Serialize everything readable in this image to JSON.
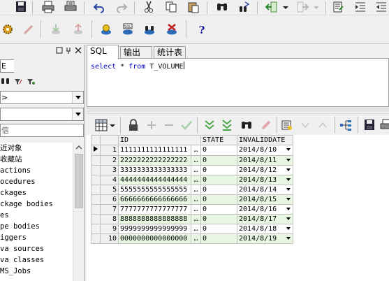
{
  "left_panel": {
    "filter_char": "E",
    "combo1": ">",
    "filter_text": "信",
    "tree_items": [
      "近对象",
      "收藏站",
      "actions",
      "ocedures",
      "ckages",
      "ckage bodies",
      "es",
      "pe bodies",
      "iggers",
      "va sources",
      "va classes",
      "MS_Jobs"
    ]
  },
  "sql_tabs": [
    "SQL",
    "输出",
    "统计表"
  ],
  "editor": {
    "kw_select": "select",
    "star": "*",
    "kw_from": "from",
    "table": "T_VOLUME"
  },
  "grid": {
    "columns": [
      "ID",
      "STATE",
      "INVALIDDATE"
    ],
    "ellipsis": "…",
    "rows": [
      {
        "n": "1",
        "id": "1111111111111111",
        "state": "0",
        "date": "2014/8/10"
      },
      {
        "n": "2",
        "id": "2222222222222222",
        "state": "0",
        "date": "2014/8/11"
      },
      {
        "n": "3",
        "id": "3333333333333333",
        "state": "0",
        "date": "2014/8/12"
      },
      {
        "n": "4",
        "id": "4444444444444444",
        "state": "0",
        "date": "2014/8/13"
      },
      {
        "n": "5",
        "id": "5555555555555555",
        "state": "0",
        "date": "2014/8/14"
      },
      {
        "n": "6",
        "id": "6666666666666666",
        "state": "0",
        "date": "2014/8/15"
      },
      {
        "n": "7",
        "id": "7777777777777777",
        "state": "0",
        "date": "2014/8/16"
      },
      {
        "n": "8",
        "id": "8888888888888888",
        "state": "0",
        "date": "2014/8/17"
      },
      {
        "n": "9",
        "id": "9999999999999999",
        "state": "0",
        "date": "2014/8/18"
      },
      {
        "n": "10",
        "id": "0000000000000000",
        "state": "0",
        "date": "2014/8/19"
      }
    ]
  },
  "colors": {
    "keyword": "#0000c0",
    "alt_row": "#e8f7e2",
    "help": "#1a1aa0"
  },
  "icons": {
    "toolbar1": [
      "save-icon",
      "print-icon",
      "print-preview-icon",
      "undo-icon",
      "redo-icon",
      "cut-icon",
      "copy-icon",
      "paste-icon",
      "find-icon",
      "find-next-icon",
      "back-icon",
      "forward-icon",
      "properties-icon",
      "indent-icon"
    ],
    "toolbar2": [
      "gears-icon",
      "wand-icon",
      "download-icon",
      "upload-icon",
      "db-commit-icon",
      "sql-query-icon",
      "db-run-icon",
      "db-stop-icon",
      "help-icon"
    ]
  }
}
